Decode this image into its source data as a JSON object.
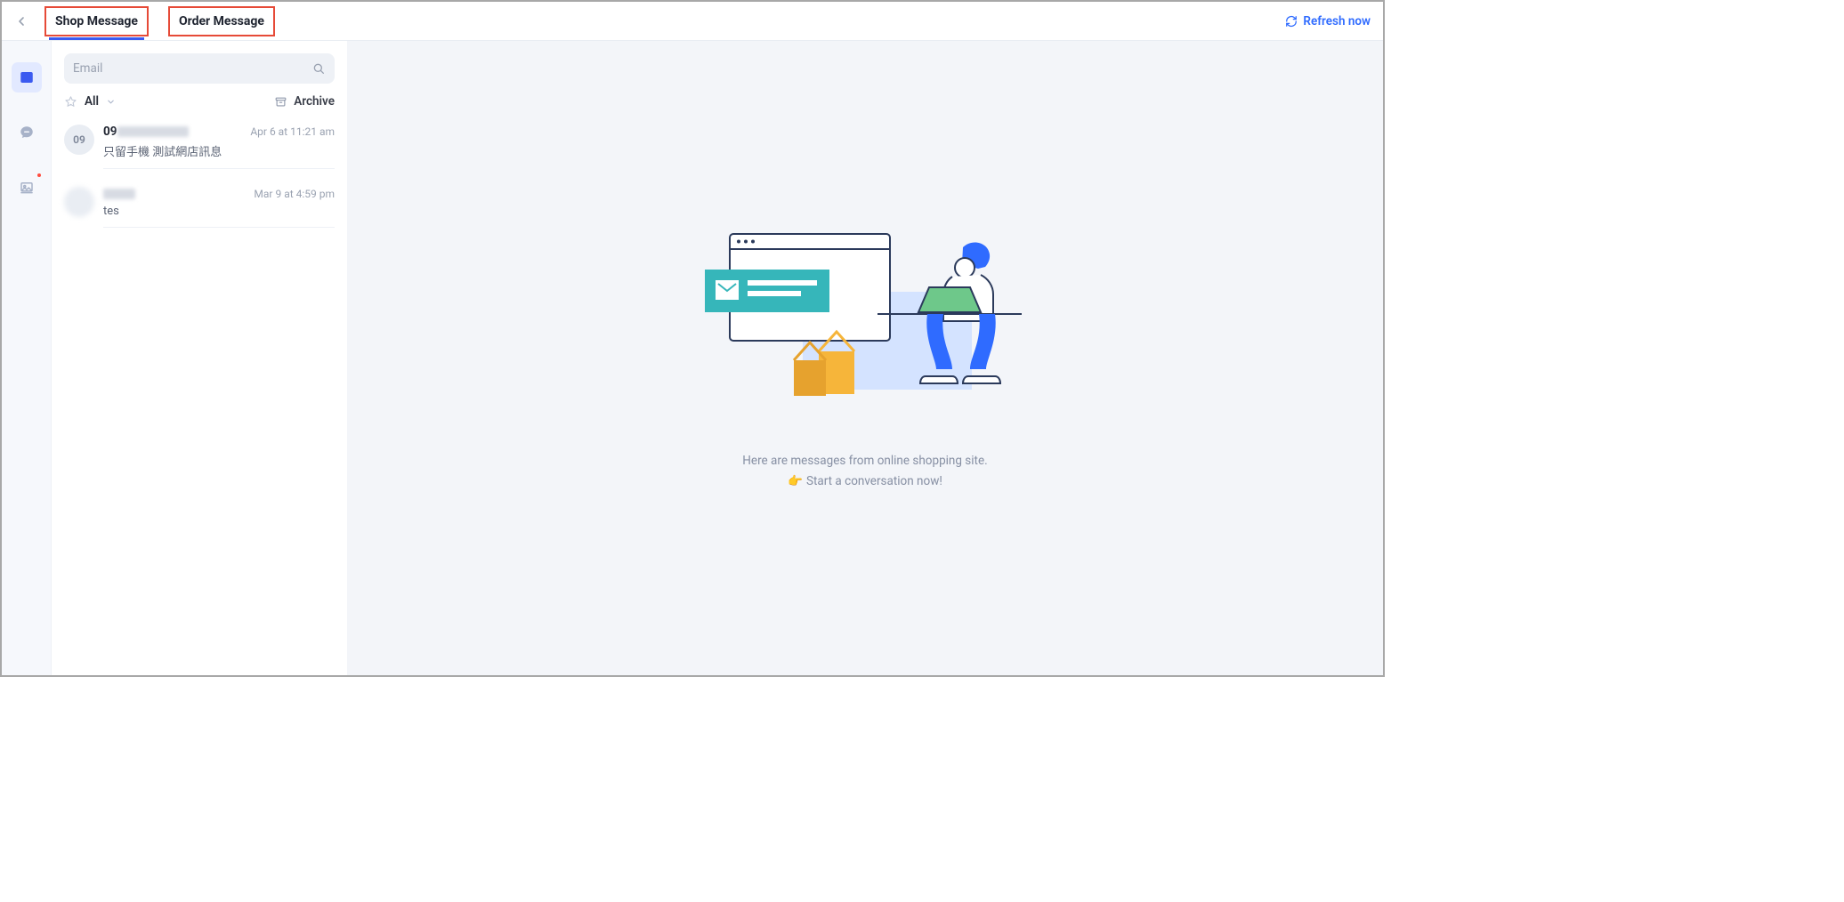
{
  "topbar": {
    "tabs": [
      {
        "label": "Shop Message",
        "active": true
      },
      {
        "label": "Order Message",
        "active": false
      }
    ],
    "refresh_label": "Refresh now"
  },
  "rail": {
    "items": [
      {
        "icon": "mail-icon",
        "active": true,
        "badge": false
      },
      {
        "icon": "chat-icon",
        "active": false,
        "badge": false
      },
      {
        "icon": "image-icon",
        "active": false,
        "badge": true
      }
    ]
  },
  "listpane": {
    "search_placeholder": "Email",
    "filter_label": "All",
    "archive_label": "Archive",
    "threads": [
      {
        "avatar_text": "09",
        "sender_visible": "09",
        "sender_obscured": true,
        "timestamp": "Apr 6 at 11:21 am",
        "preview": "只留手機 測試網店訊息"
      },
      {
        "avatar_text": "",
        "avatar_blurred": true,
        "sender_visible": "",
        "sender_obscured": true,
        "timestamp": "Mar 9 at 4:59 pm",
        "preview": "tes"
      }
    ]
  },
  "main": {
    "empty_line1": "Here are messages from online shopping site.",
    "empty_line2_emoji": "👉",
    "empty_line2": "Start a conversation now!"
  }
}
